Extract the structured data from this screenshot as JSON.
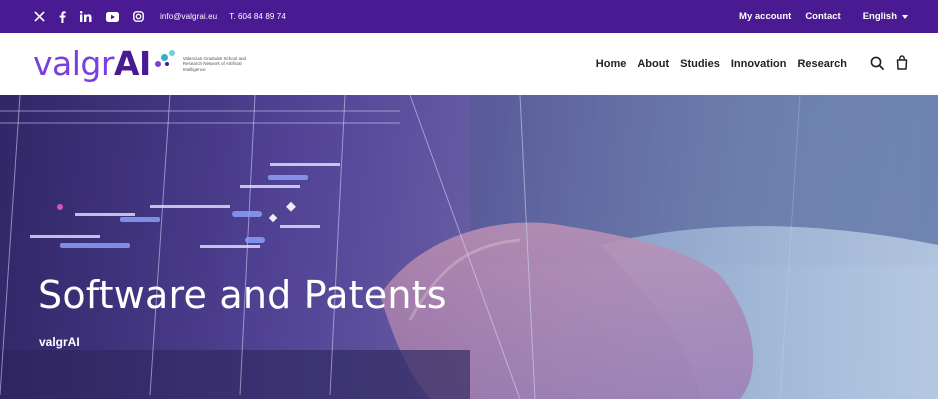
{
  "topbar": {
    "email": "info@valgrai.eu",
    "phone": "T. 604 84 89 74",
    "my_account": "My account",
    "contact": "Contact",
    "language": "English"
  },
  "header": {
    "logo_text_a": "valgr",
    "logo_text_b": "AI",
    "logo_tagline": "Valencian Graduate School and Research Network of Artificial Intelligence",
    "nav": [
      {
        "label": "Home"
      },
      {
        "label": "About"
      },
      {
        "label": "Studies"
      },
      {
        "label": "Innovation"
      },
      {
        "label": "Research"
      }
    ]
  },
  "hero": {
    "title": "Software and Patents",
    "subtitle": "valgrAI"
  },
  "colors": {
    "brand_dark": "#4a1a93",
    "brand_light": "#7b3fe0"
  },
  "icons": [
    "x-icon",
    "facebook-icon",
    "linkedin-icon",
    "youtube-icon",
    "instagram-icon",
    "search-icon",
    "bag-icon"
  ]
}
